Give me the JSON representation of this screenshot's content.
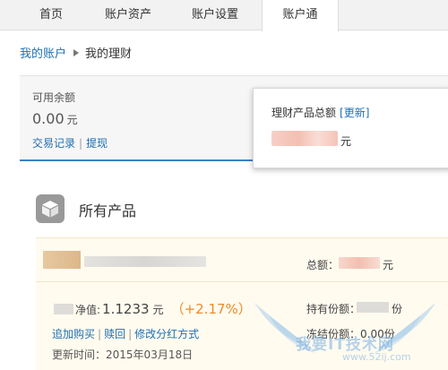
{
  "nav": {
    "tabs": [
      {
        "label": "首页",
        "active": false
      },
      {
        "label": "账户资产",
        "active": false
      },
      {
        "label": "账户设置",
        "active": false
      },
      {
        "label": "账户通",
        "active": true
      }
    ]
  },
  "breadcrumb": {
    "root": "我的账户",
    "current": "我的理财"
  },
  "balance": {
    "label": "可用余额",
    "amount": "0.00",
    "unit": "元",
    "link_transactions": "交易记录",
    "link_withdraw": "提现"
  },
  "popup": {
    "title": "理财产品总额",
    "refresh": "[更新]",
    "unit": "元"
  },
  "products": {
    "header": "所有产品",
    "card": {
      "total_label": "总额：",
      "total_unit": "元",
      "nav_label": "净值:",
      "nav_value": "1.1233",
      "nav_unit": "元",
      "nav_change": "（+2.17%）",
      "holding_label": "持有份额：",
      "holding_unit": "份",
      "frozen_label": "冻结份额：",
      "frozen_value": "0.00",
      "frozen_unit": "份",
      "action_buy": "追加购买",
      "action_redeem": "赎回",
      "action_dividend": "修改分红方式",
      "updated_label": "更新时间：",
      "updated_date": "2015年03月18日"
    }
  },
  "watermark": {
    "logo": "我要IT技术网",
    "url": "www.52ij.com"
  },
  "colors": {
    "link": "#1f6fb2",
    "accent_bar": "#3b83c0",
    "change_positive": "#f08a26",
    "card_bg": "#fffbef"
  }
}
